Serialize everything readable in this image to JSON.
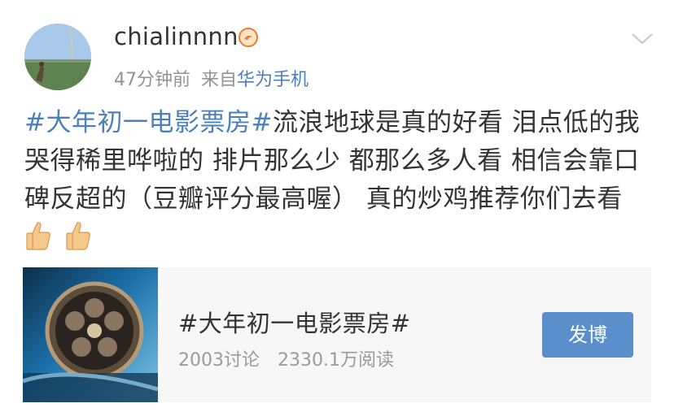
{
  "post": {
    "author": {
      "name": "chialinnnn",
      "badge_icon": "sunny-badge-icon"
    },
    "meta": {
      "time": "47分钟前",
      "source_prefix": "来自",
      "source": "华为手机"
    },
    "text": {
      "topic": "#大年初一电影票房#",
      "body": "流浪地球是真的好看 泪点低的我哭得稀里哗啦的 排片那么少 都那么多人看 相信会靠口碑反超的（豆瓣评分最高喔） 真的炒鸡推荐你们去看"
    },
    "emojis": [
      "thumbs-up-icon",
      "thumbs-up-icon"
    ]
  },
  "topic_card": {
    "title": "#大年初一电影票房#",
    "discussions": "2003讨论",
    "reads": "2330.1万阅读",
    "button_label": "发博"
  },
  "colors": {
    "link": "#4d7fb9",
    "button": "#5a8fcc",
    "card_bg": "#f7f7f7"
  }
}
